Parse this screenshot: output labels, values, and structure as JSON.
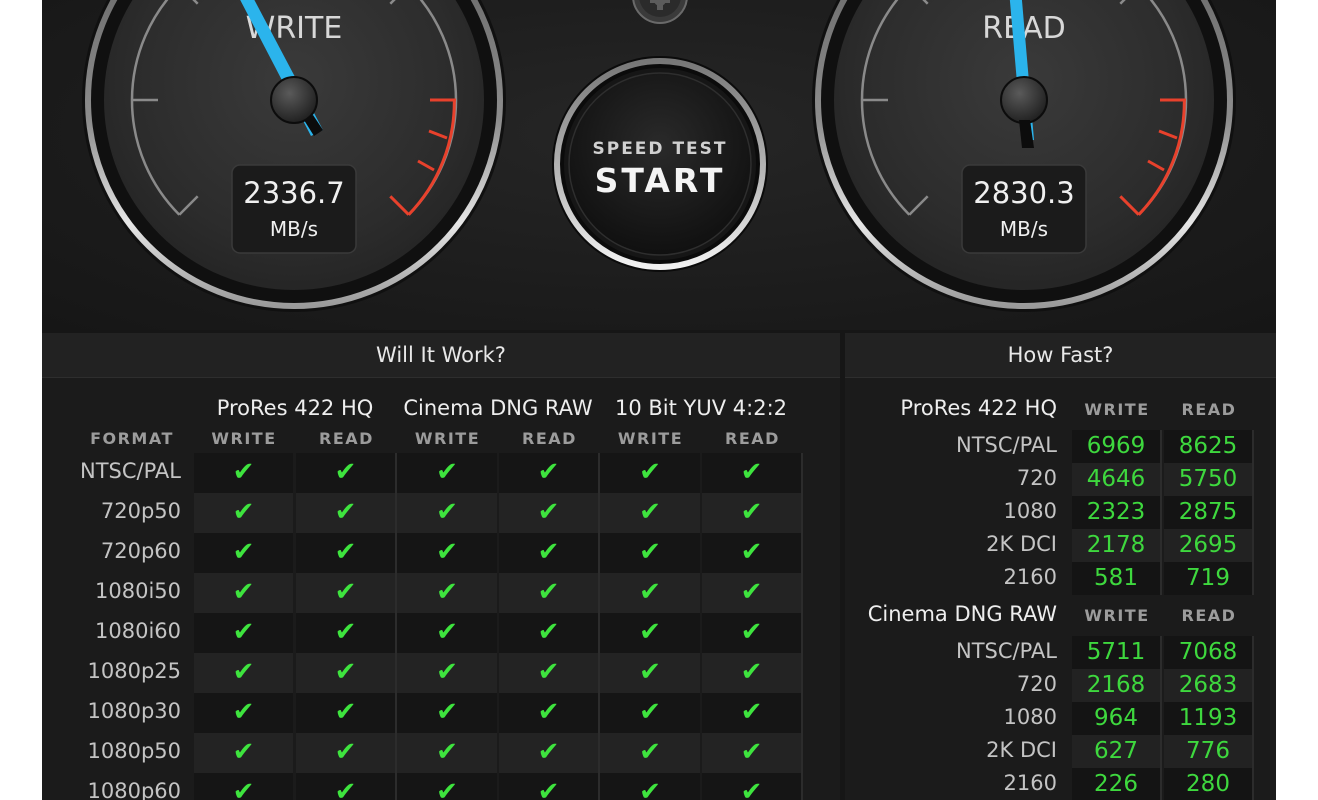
{
  "colors": {
    "needle": "#2bb4ec",
    "redzone": "#e8412c",
    "check": "#3ee43e",
    "number": "#3ed83e"
  },
  "icons": {
    "settings": "gear-icon",
    "check": "checkmark-icon"
  },
  "gauges": {
    "write": {
      "label": "WRITE",
      "value": "2336.7",
      "unit": "MB/s"
    },
    "read": {
      "label": "READ",
      "value": "2830.3",
      "unit": "MB/s"
    }
  },
  "start_button": {
    "line1": "SPEED TEST",
    "line2": "START"
  },
  "will_it_work": {
    "title": "Will It Work?",
    "format_header": "FORMAT",
    "groups": [
      {
        "name": "ProRes 422 HQ",
        "write": "WRITE",
        "read": "READ"
      },
      {
        "name": "Cinema DNG RAW",
        "write": "WRITE",
        "read": "READ"
      },
      {
        "name": "10 Bit YUV 4:2:2",
        "write": "WRITE",
        "read": "READ"
      }
    ],
    "check_glyph": "✔",
    "formats": [
      {
        "label": "NTSC/PAL",
        "checks": [
          true,
          true,
          true,
          true,
          true,
          true
        ]
      },
      {
        "label": "720p50",
        "checks": [
          true,
          true,
          true,
          true,
          true,
          true
        ]
      },
      {
        "label": "720p60",
        "checks": [
          true,
          true,
          true,
          true,
          true,
          true
        ]
      },
      {
        "label": "1080i50",
        "checks": [
          true,
          true,
          true,
          true,
          true,
          true
        ]
      },
      {
        "label": "1080i60",
        "checks": [
          true,
          true,
          true,
          true,
          true,
          true
        ]
      },
      {
        "label": "1080p25",
        "checks": [
          true,
          true,
          true,
          true,
          true,
          true
        ]
      },
      {
        "label": "1080p30",
        "checks": [
          true,
          true,
          true,
          true,
          true,
          true
        ]
      },
      {
        "label": "1080p50",
        "checks": [
          true,
          true,
          true,
          true,
          true,
          true
        ]
      },
      {
        "label": "1080p60",
        "checks": [
          true,
          true,
          true,
          true,
          true,
          true
        ]
      }
    ]
  },
  "how_fast": {
    "title": "How Fast?",
    "sections": [
      {
        "name": "ProRes 422 HQ",
        "write_header": "WRITE",
        "read_header": "READ",
        "rows": [
          {
            "label": "NTSC/PAL",
            "write": "6969",
            "read": "8625"
          },
          {
            "label": "720",
            "write": "4646",
            "read": "5750"
          },
          {
            "label": "1080",
            "write": "2323",
            "read": "2875"
          },
          {
            "label": "2K DCI",
            "write": "2178",
            "read": "2695"
          },
          {
            "label": "2160",
            "write": "581",
            "read": "719"
          }
        ]
      },
      {
        "name": "Cinema DNG RAW",
        "write_header": "WRITE",
        "read_header": "READ",
        "rows": [
          {
            "label": "NTSC/PAL",
            "write": "5711",
            "read": "7068"
          },
          {
            "label": "720",
            "write": "2168",
            "read": "2683"
          },
          {
            "label": "1080",
            "write": "964",
            "read": "1193"
          },
          {
            "label": "2K DCI",
            "write": "627",
            "read": "776"
          },
          {
            "label": "2160",
            "write": "226",
            "read": "280"
          }
        ]
      }
    ]
  }
}
